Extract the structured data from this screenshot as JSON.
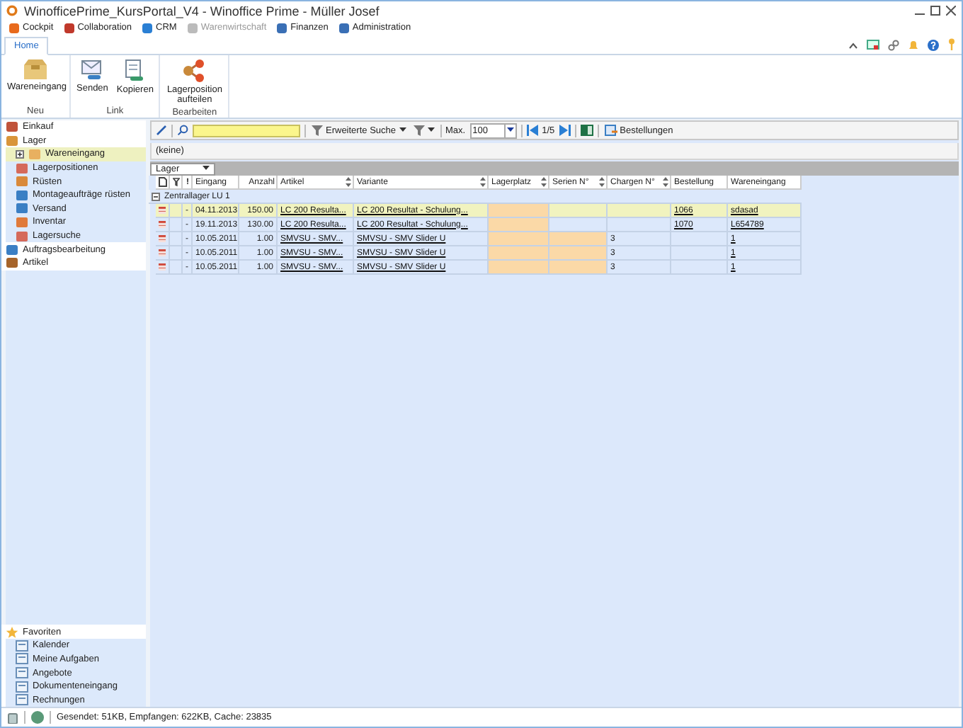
{
  "window": {
    "title": "WinofficePrime_KursPortal_V4 - Winoffice Prime - Müller Josef"
  },
  "menu": [
    {
      "label": "Cockpit",
      "disabled": false
    },
    {
      "label": "Collaboration",
      "disabled": false
    },
    {
      "label": "CRM",
      "disabled": false
    },
    {
      "label": "Warenwirtschaft",
      "disabled": true
    },
    {
      "label": "Finanzen",
      "disabled": false
    },
    {
      "label": "Administration",
      "disabled": false
    }
  ],
  "tabs": [
    {
      "label": "Home",
      "selected": true
    }
  ],
  "ribbon": [
    {
      "group": "Neu",
      "buttons": [
        "Wareneingang"
      ]
    },
    {
      "group": "Link",
      "buttons": [
        "Senden",
        "Kopieren"
      ]
    },
    {
      "group": "Bearbeiten",
      "buttons": [
        "Lagerposition aufteilen"
      ]
    }
  ],
  "sidebar": {
    "items": [
      {
        "label": "Einkauf",
        "selected": false
      },
      {
        "label": "Lager",
        "selected": false,
        "children": [
          {
            "label": "Wareneingang",
            "selected": true
          },
          {
            "label": "Lagerpositionen",
            "selected": false
          },
          {
            "label": "Rüsten",
            "selected": false
          },
          {
            "label": "Montageaufträge rüsten",
            "selected": false
          },
          {
            "label": "Versand",
            "selected": false
          },
          {
            "label": "Inventar",
            "selected": false
          },
          {
            "label": "Lagersuche",
            "selected": false
          }
        ]
      },
      {
        "label": "Auftragsbearbeitung",
        "selected": false
      },
      {
        "label": "Artikel",
        "selected": false
      }
    ],
    "favorites": {
      "label": "Favoriten",
      "items": [
        "Kalender",
        "Meine Aufgaben",
        "Angebote",
        "Dokumenteneingang",
        "Rechnungen"
      ]
    }
  },
  "toolbar": {
    "advanced_search": "Erweiterte Suche",
    "max_label": "Max.",
    "max_value": "100",
    "page": "1/5",
    "orders": "Bestellungen"
  },
  "filter_text": "(keine)",
  "grouping": "Lager",
  "table": {
    "columns": [
      {
        "label": "!",
        "sortable": false
      },
      {
        "label": "Eingang",
        "sortable": false
      },
      {
        "label": "Anzahl",
        "sortable": false
      },
      {
        "label": "Artikel",
        "sortable": true
      },
      {
        "label": "Variante",
        "sortable": true
      },
      {
        "label": "Lagerplatz",
        "sortable": true
      },
      {
        "label": "Serien N°",
        "sortable": true
      },
      {
        "label": "Chargen N°",
        "sortable": true
      },
      {
        "label": "Bestellung",
        "sortable": false
      },
      {
        "label": "Wareneingang",
        "sortable": false
      }
    ],
    "group": "Zentrallager LU 1",
    "rows": [
      {
        "selected": true,
        "flag": "-",
        "eingang": "04.11.2013",
        "anzahl": "150.00",
        "artikel": "LC 200 Resulta...",
        "variante": "LC 200 Resultat - Schulung...",
        "lagerplatz": "",
        "lagerplatz_highlighted": true,
        "serien": "",
        "serien_highlighted": false,
        "chargen": "",
        "bestellung": "1066",
        "wareneingang": "sdasad"
      },
      {
        "selected": false,
        "flag": "-",
        "eingang": "19.11.2013",
        "anzahl": "130.00",
        "artikel": "LC 200 Resulta...",
        "variante": "LC 200 Resultat - Schulung...",
        "lagerplatz": "",
        "lagerplatz_highlighted": true,
        "serien": "",
        "serien_highlighted": false,
        "chargen": "",
        "bestellung": "1070",
        "wareneingang": "L654789"
      },
      {
        "selected": false,
        "flag": "-",
        "eingang": "10.05.2011",
        "anzahl": "1.00",
        "artikel": "SMVSU - SMV...",
        "variante": "SMVSU - SMV Slider U",
        "lagerplatz": "",
        "lagerplatz_highlighted": true,
        "serien": "",
        "serien_highlighted": true,
        "chargen": "3",
        "bestellung": "",
        "wareneingang": "1"
      },
      {
        "selected": false,
        "flag": "-",
        "eingang": "10.05.2011",
        "anzahl": "1.00",
        "artikel": "SMVSU - SMV...",
        "variante": "SMVSU - SMV Slider U",
        "lagerplatz": "",
        "lagerplatz_highlighted": true,
        "serien": "",
        "serien_highlighted": true,
        "chargen": "3",
        "bestellung": "",
        "wareneingang": "1"
      },
      {
        "selected": false,
        "flag": "-",
        "eingang": "10.05.2011",
        "anzahl": "1.00",
        "artikel": "SMVSU - SMV...",
        "variante": "SMVSU - SMV Slider U",
        "lagerplatz": "",
        "lagerplatz_highlighted": true,
        "serien": "",
        "serien_highlighted": true,
        "chargen": "3",
        "bestellung": "",
        "wareneingang": "1"
      }
    ]
  },
  "status_bar": {
    "text": "Gesendet: 51KB, Empfangen: 622KB, Cache: 23835"
  }
}
